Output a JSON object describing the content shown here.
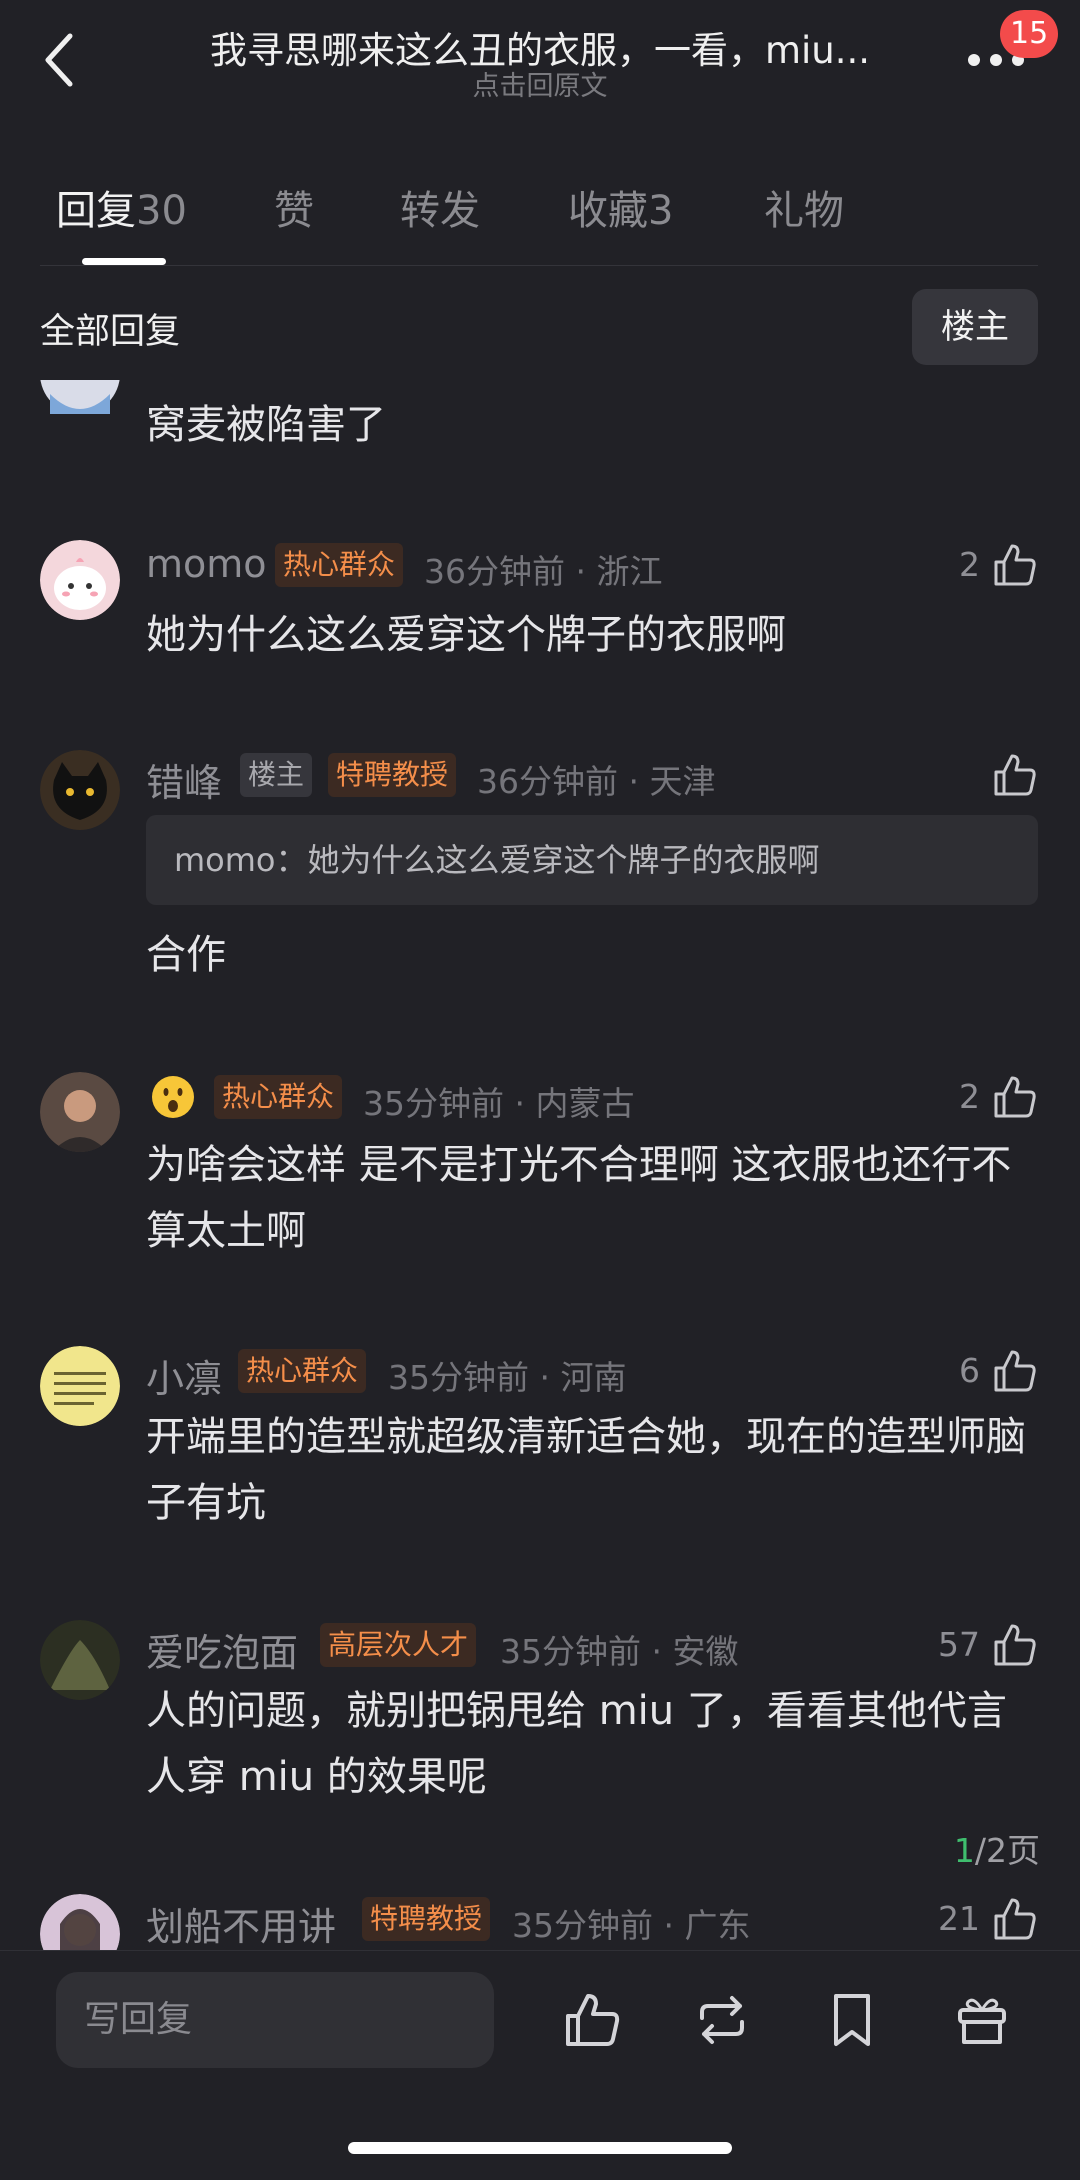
{
  "header": {
    "title": "我寻思哪来这么丑的衣服，一看，miu...",
    "subtitle": "点击回原文",
    "notification_count": "15"
  },
  "tabs": [
    {
      "label": "回复",
      "count": "30"
    },
    {
      "label": "赞",
      "count": ""
    },
    {
      "label": "转发",
      "count": ""
    },
    {
      "label": "收藏",
      "count": "3"
    },
    {
      "label": "礼物",
      "count": ""
    }
  ],
  "section": {
    "title": "全部回复",
    "op_filter": "楼主"
  },
  "comments": [
    {
      "content": "窝麦被陷害了"
    },
    {
      "name": "momo",
      "tag": "热心群众",
      "meta": "36分钟前 · 浙江",
      "likes": "2",
      "content": "她为什么这么爱穿这个牌子的衣服啊"
    },
    {
      "name": "错峰",
      "op_tag": "楼主",
      "tag": "特聘教授",
      "meta": "36分钟前 · 天津",
      "likes": "",
      "quote": "momo：她为什么这么爱穿这个牌子的衣服啊",
      "content": "合作"
    },
    {
      "name": "😮",
      "tag": "热心群众",
      "meta": "35分钟前 · 内蒙古",
      "likes": "2",
      "content": "为啥会这样 是不是打光不合理啊 这衣服也还行不算太土啊"
    },
    {
      "name": "小凛",
      "tag": "热心群众",
      "meta": "35分钟前 · 河南",
      "likes": "6",
      "content": "开端里的造型就超级清新适合她，现在的造型师脑子有坑"
    },
    {
      "name": "爱吃泡面",
      "tag": "高层次人才",
      "meta": "35分钟前 · 安徽",
      "likes": "57",
      "content": "人的问题，就别把锅甩给 miu 了，看看其他代言人穿 miu 的效果呢"
    },
    {
      "name": "划船不用讲",
      "tag": "特聘教授",
      "meta": "35分钟前 · 广东",
      "likes": "21"
    }
  ],
  "pager": {
    "current": "1",
    "total": "/2页"
  },
  "bottom_bar": {
    "reply_placeholder": "写回复"
  },
  "colors": {
    "background": "#212126",
    "tag_orange": "#f48e4a",
    "badge_red": "#f34b4b",
    "pager_current": "#3fbe6e"
  }
}
